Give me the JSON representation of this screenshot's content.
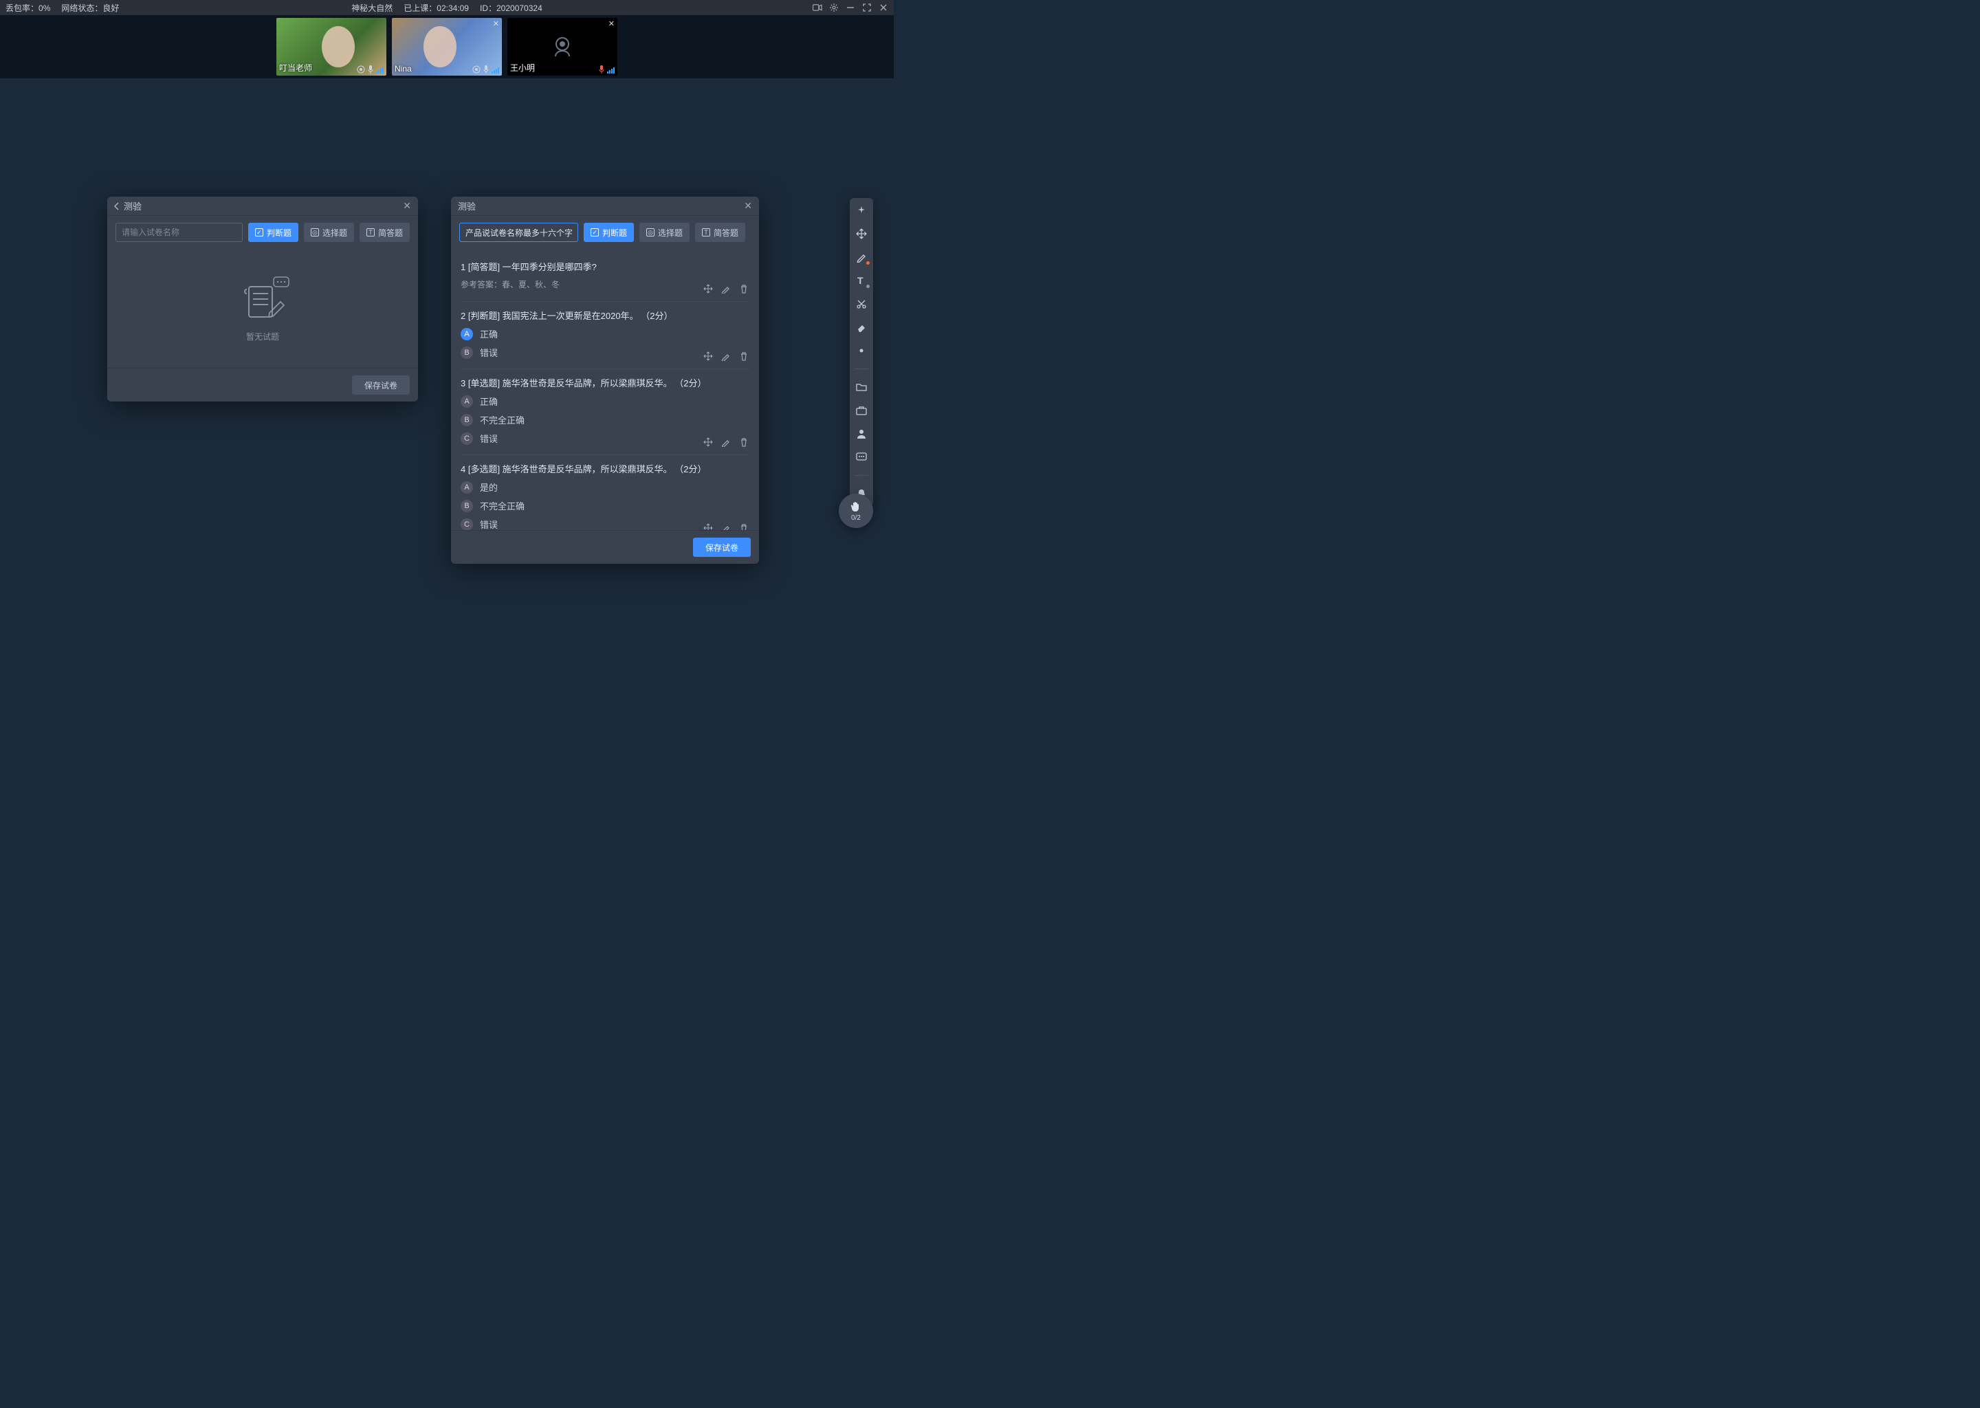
{
  "topbar": {
    "packet_loss_label": "丢包率：",
    "packet_loss_value": "0%",
    "network_label": "网络状态：",
    "network_value": "良好",
    "course_title": "神秘大自然",
    "duration_label": "已上课：",
    "duration_value": "02:34:09",
    "id_label": "ID：",
    "id_value": "2020070324"
  },
  "videos": [
    {
      "name": "叮当老师",
      "has_close": false,
      "camera_off": false,
      "avatar_bg": "#5a8f4a",
      "mic_color": "#cfd6e0"
    },
    {
      "name": "Nina",
      "has_close": true,
      "camera_off": false,
      "avatar_bg": "#7b93c8",
      "mic_color": "#cfd6e0"
    },
    {
      "name": "王小明",
      "has_close": true,
      "camera_off": true,
      "avatar_bg": "#000",
      "mic_color": "#ff5a3d"
    }
  ],
  "left_panel": {
    "title": "测验",
    "name_placeholder": "请输入试卷名称",
    "btn_judge": "判断题",
    "btn_choice": "选择题",
    "btn_short": "简答题",
    "empty_text": "暂无试题",
    "save_label": "保存试卷"
  },
  "right_panel": {
    "title": "测验",
    "name_value": "产品说试卷名称最多十六个字",
    "btn_judge": "判断题",
    "btn_choice": "选择题",
    "btn_short": "简答题",
    "save_label": "保存试卷",
    "answer_ref_prefix": "参考答案：",
    "questions": [
      {
        "num": 1,
        "type_label": "[简答题]",
        "text": "一年四季分别是哪四季?",
        "ref_answer": "春、夏、秋、冬",
        "options": []
      },
      {
        "num": 2,
        "type_label": "[判断题]",
        "text": "我国宪法上一次更新是在2020年。",
        "points": "（2分）",
        "options": [
          {
            "key": "A",
            "text": "正确",
            "selected": true
          },
          {
            "key": "B",
            "text": "错误",
            "selected": false
          }
        ]
      },
      {
        "num": 3,
        "type_label": "[单选题]",
        "text": "施华洛世奇是反华品牌，所以梁鼎琪反华。",
        "points": "（2分）",
        "options": [
          {
            "key": "A",
            "text": "正确",
            "selected": false
          },
          {
            "key": "B",
            "text": "不完全正确",
            "selected": false
          },
          {
            "key": "C",
            "text": "错误",
            "selected": false
          }
        ]
      },
      {
        "num": 4,
        "type_label": "[多选题]",
        "text": "施华洛世奇是反华品牌，所以梁鼎琪反华。",
        "points": "（2分）",
        "options": [
          {
            "key": "A",
            "text": "是的",
            "selected": false
          },
          {
            "key": "B",
            "text": "不完全正确",
            "selected": false
          },
          {
            "key": "C",
            "text": "错误",
            "selected": false
          }
        ]
      }
    ]
  },
  "hand": {
    "count": "0/2"
  },
  "colors": {
    "primary": "#3d8dff",
    "panel": "#3a4250",
    "bg": "#1b2a3a"
  }
}
